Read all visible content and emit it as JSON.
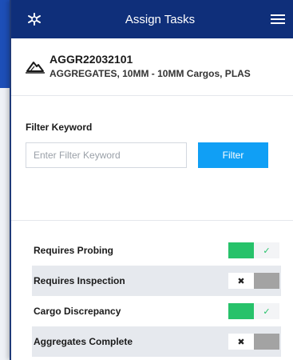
{
  "header": {
    "title": "Assign Tasks",
    "logo_icon": "snowflake-logo-icon",
    "menu_icon": "hamburger-menu-icon",
    "bg_color": "#0f2f7a"
  },
  "cargo": {
    "icon": "mountain-icon",
    "id": "AGGR22032101",
    "description": "AGGREGATES, 10MM - 10MM Cargos, PLAS"
  },
  "filter": {
    "label": "Filter Keyword",
    "placeholder": "Enter Filter Keyword",
    "value": "",
    "button_label": "Filter",
    "button_color": "#109ff5"
  },
  "toggles": [
    {
      "label": "Requires Probing",
      "on": true
    },
    {
      "label": "Requires Inspection",
      "on": false
    },
    {
      "label": "Cargo Discrepancy",
      "on": true
    },
    {
      "label": "Aggregates Complete",
      "on": false
    }
  ],
  "colors": {
    "toggle_on": "#27c26a",
    "toggle_off": "#a3a3a3"
  }
}
